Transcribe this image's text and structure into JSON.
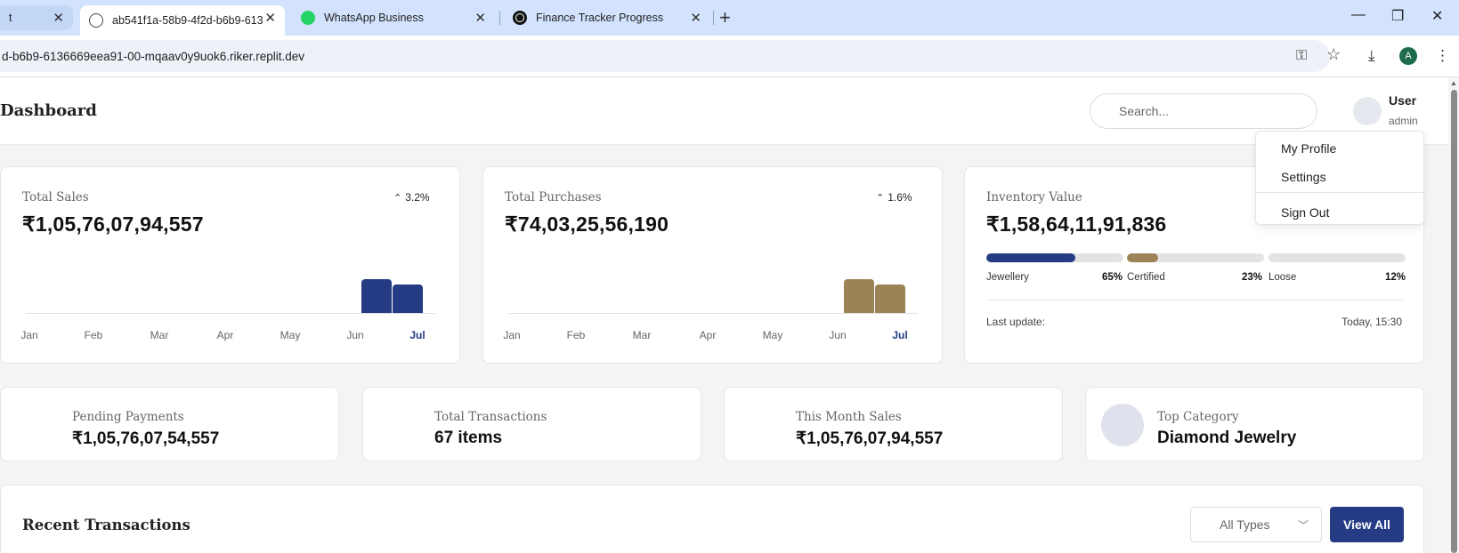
{
  "browser": {
    "tabs": [
      {
        "title": "t",
        "active": false
      },
      {
        "title": "ab541f1a-58b9-4f2d-b6b9-613",
        "active": true
      },
      {
        "title": "WhatsApp Business",
        "active": false
      },
      {
        "title": "Finance Tracker Progress",
        "active": false
      }
    ],
    "url": "d-b6b9-6136669eea91-00-mqaav0y9uok6.riker.replit.dev",
    "profile_initial": "A"
  },
  "header": {
    "title": "Dashboard",
    "search_placeholder": "Search...",
    "user_name": "User",
    "user_role": "admin"
  },
  "user_menu": {
    "items": [
      "My Profile",
      "Settings",
      "Sign Out"
    ]
  },
  "sales_card": {
    "label": "Total Sales",
    "value": "₹1,05,76,07,94,557",
    "trend": "3.2%"
  },
  "purchases_card": {
    "label": "Total Purchases",
    "value": "₹74,03,25,56,190",
    "trend": "1.6%"
  },
  "inventory_card": {
    "label": "Inventory Value",
    "value": "₹1,58,64,11,91,836",
    "segments": [
      {
        "name": "Jewellery",
        "pct": "65%",
        "fraction": 0.65,
        "color": "#253c85"
      },
      {
        "name": "Certified",
        "pct": "23%",
        "fraction": 0.23,
        "color": "#9c8257"
      },
      {
        "name": "Loose",
        "pct": "12%",
        "fraction": 0,
        "color": "#cfcfcf"
      }
    ],
    "last_update_label": "Last update:",
    "last_update_time": "Today, 15:30"
  },
  "stats": [
    {
      "label": "Pending Payments",
      "value": "₹1,05,76,07,54,557"
    },
    {
      "label": "Total Transactions",
      "value": "67 items"
    },
    {
      "label": "This Month Sales",
      "value": "₹1,05,76,07,94,557"
    },
    {
      "label": "Top Category",
      "value": "Diamond Jewelry"
    }
  ],
  "recent": {
    "title": "Recent Transactions",
    "filter_value": "All Types",
    "view_all_label": "View All"
  },
  "chart_data": [
    {
      "type": "bar",
      "title": "Total Sales",
      "categories": [
        "Jan",
        "Feb",
        "Mar",
        "Apr",
        "May",
        "Jun",
        "Jul"
      ],
      "values": [
        0,
        0,
        0,
        0,
        0,
        1.0,
        0.84
      ],
      "color": "#253c85",
      "highlight_category": "Jul"
    },
    {
      "type": "bar",
      "title": "Total Purchases",
      "categories": [
        "Jan",
        "Feb",
        "Mar",
        "Apr",
        "May",
        "Jun",
        "Jul"
      ],
      "values": [
        0,
        0,
        0,
        0,
        0,
        1.0,
        0.84
      ],
      "color": "#9c8257",
      "highlight_category": "Jul"
    }
  ]
}
